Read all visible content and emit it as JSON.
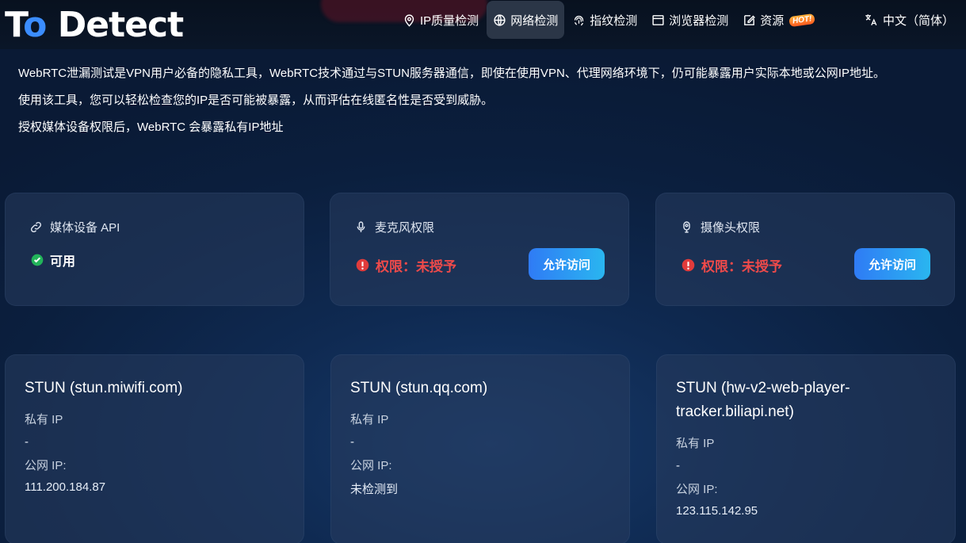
{
  "header": {
    "logo_main": "To Detect",
    "nav": [
      {
        "label": "IP质量检测",
        "icon": "location-pin-icon"
      },
      {
        "label": "网络检测",
        "icon": "globe-icon",
        "active": true
      },
      {
        "label": "指纹检测",
        "icon": "fingerprint-icon"
      },
      {
        "label": "浏览器检测",
        "icon": "browser-window-icon"
      },
      {
        "label": "资源",
        "icon": "edit-doc-icon",
        "badge": "HOT!"
      }
    ],
    "language": {
      "label": "中文（简体）",
      "icon": "translate-icon"
    }
  },
  "intro": [
    "WebRTC泄漏测试是VPN用户必备的隐私工具，WebRTC技术通过与STUN服务器通信，即使在使用VPN、代理网络环境下，仍可能暴露用户实际本地或公网IP地址。",
    "使用该工具，您可以轻松检查您的IP是否可能被暴露，从而评估在线匿名性是否受到威胁。",
    "授权媒体设备权限后，WebRTC 会暴露私有IP地址"
  ],
  "permissions": [
    {
      "title": "媒体设备 API",
      "icon": "link-icon",
      "status": "可用",
      "status_type": "ok"
    },
    {
      "title": "麦克风权限",
      "icon": "microphone-icon",
      "status": "权限：未授予",
      "status_type": "denied",
      "button": "允许访问"
    },
    {
      "title": "摄像头权限",
      "icon": "camera-icon",
      "status": "权限：未授予",
      "status_type": "denied",
      "button": "允许访问"
    }
  ],
  "stun": [
    {
      "title": "STUN (stun.miwifi.com)",
      "private_label": "私有 IP",
      "private_value": "-",
      "public_label": "公网 IP:",
      "public_value": "111.200.184.87"
    },
    {
      "title": "STUN (stun.qq.com)",
      "private_label": "私有 IP",
      "private_value": "-",
      "public_label": "公网 IP:",
      "public_value": "未检测到"
    },
    {
      "title": "STUN (hw-v2-web-player-tracker.biliapi.net)",
      "private_label": "私有 IP",
      "private_value": "-",
      "public_label": "公网 IP:",
      "public_value": "123.115.142.95"
    }
  ],
  "colors": {
    "accent": "#3b8dff",
    "danger": "#ef4a4a",
    "ok": "#22b45a",
    "button_start": "#2f7bf5",
    "button_end": "#2ab6f0"
  }
}
